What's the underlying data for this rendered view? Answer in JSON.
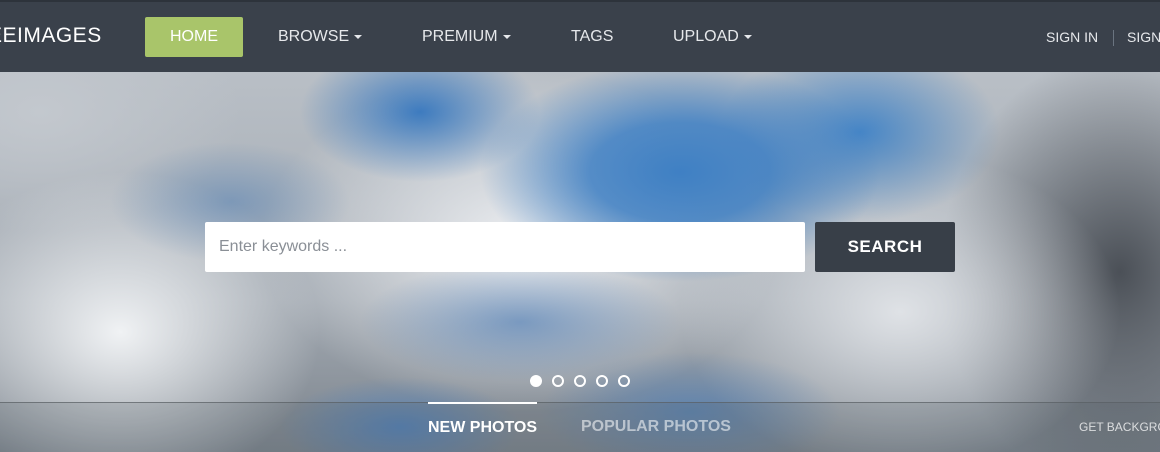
{
  "navbar": {
    "logo": "EEIMAGES",
    "items": [
      {
        "label": "HOME",
        "active": true
      },
      {
        "label": "BROWSE",
        "dropdown": true
      },
      {
        "label": "PREMIUM",
        "dropdown": true
      },
      {
        "label": "TAGS"
      },
      {
        "label": "UPLOAD",
        "dropdown": true
      }
    ],
    "sign_in": "SIGN IN",
    "sign_up": "SIGN",
    "colors": {
      "background": "#3a414b",
      "active": "#a9c56a"
    }
  },
  "hero": {
    "search": {
      "placeholder": "Enter keywords ...",
      "value": "",
      "button_label": "SEARCH"
    },
    "carousel": {
      "slides": 5,
      "active_index": 0
    },
    "tabs": [
      {
        "label": "NEW PHOTOS",
        "active": true
      },
      {
        "label": "POPULAR PHOTOS",
        "active": false
      }
    ],
    "background_link": "GET BACKGRO"
  }
}
